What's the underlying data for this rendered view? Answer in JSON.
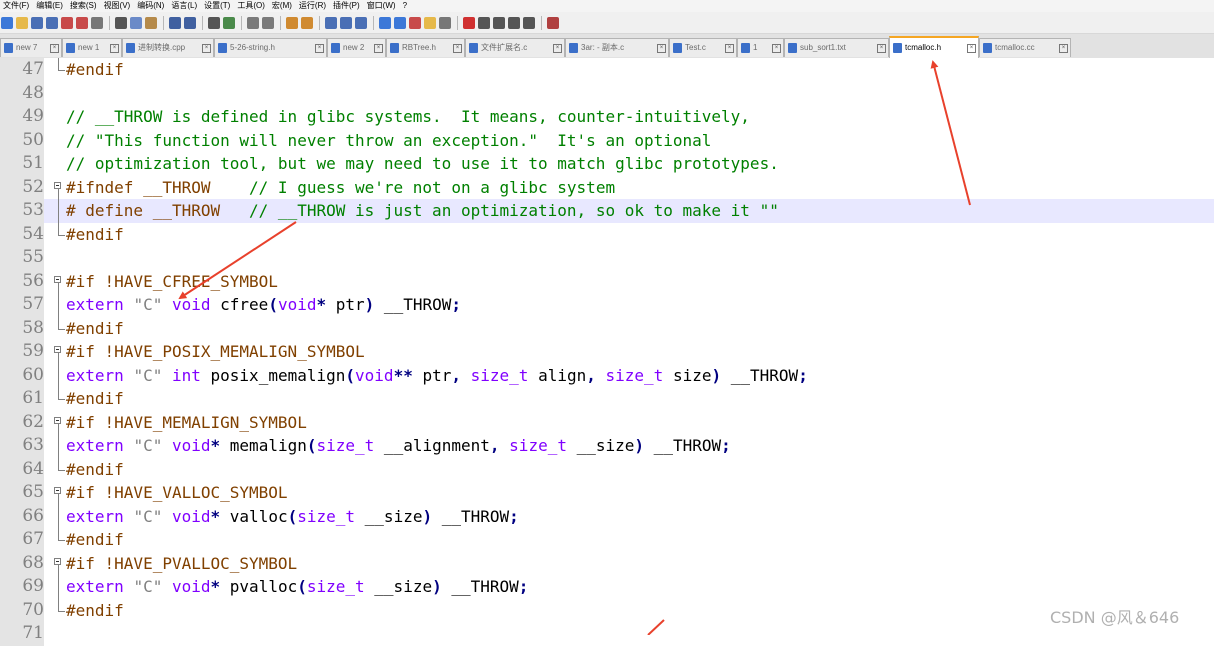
{
  "menu": [
    "文件(F)",
    "编辑(E)",
    "搜索(S)",
    "视图(V)",
    "编码(N)",
    "语言(L)",
    "设置(T)",
    "工具(O)",
    "宏(M)",
    "运行(R)",
    "插件(P)",
    "窗口(W)",
    "?"
  ],
  "toolbar_icons": [
    {
      "name": "new-file-icon",
      "color": "#3c78d8"
    },
    {
      "name": "open-file-icon",
      "color": "#e6b94a"
    },
    {
      "name": "save-icon",
      "color": "#4a6fb5"
    },
    {
      "name": "save-all-icon",
      "color": "#4a6fb5"
    },
    {
      "name": "close-icon",
      "color": "#c84a4a"
    },
    {
      "name": "close-all-icon",
      "color": "#c84a4a"
    },
    {
      "name": "print-icon",
      "color": "#777777"
    },
    {
      "name": "sep"
    },
    {
      "name": "cut-icon",
      "color": "#555555"
    },
    {
      "name": "copy-icon",
      "color": "#6a8ac8"
    },
    {
      "name": "paste-icon",
      "color": "#b58a4a"
    },
    {
      "name": "sep"
    },
    {
      "name": "undo-icon",
      "color": "#4060a0"
    },
    {
      "name": "redo-icon",
      "color": "#4060a0"
    },
    {
      "name": "sep"
    },
    {
      "name": "find-icon",
      "color": "#555555"
    },
    {
      "name": "replace-icon",
      "color": "#4a8a4a"
    },
    {
      "name": "sep"
    },
    {
      "name": "zoom-in-icon",
      "color": "#7a7a7a"
    },
    {
      "name": "zoom-out-icon",
      "color": "#7a7a7a"
    },
    {
      "name": "sep"
    },
    {
      "name": "sync-vertical-icon",
      "color": "#d08a30"
    },
    {
      "name": "sync-horizontal-icon",
      "color": "#d08a30"
    },
    {
      "name": "sep"
    },
    {
      "name": "word-wrap-icon",
      "color": "#4a6fb5"
    },
    {
      "name": "show-all-chars-icon",
      "color": "#4a6fb5"
    },
    {
      "name": "indent-guide-icon",
      "color": "#4a6fb5"
    },
    {
      "name": "sep"
    },
    {
      "name": "udl-icon",
      "color": "#3c78d8"
    },
    {
      "name": "doc-map-icon",
      "color": "#3c78d8"
    },
    {
      "name": "function-list-icon",
      "color": "#c84a4a"
    },
    {
      "name": "folder-workspace-icon",
      "color": "#e6b94a"
    },
    {
      "name": "monitoring-icon",
      "color": "#777777"
    },
    {
      "name": "sep"
    },
    {
      "name": "record-macro-icon",
      "color": "#d03030"
    },
    {
      "name": "stop-macro-icon",
      "color": "#555555"
    },
    {
      "name": "play-macro-icon",
      "color": "#555555"
    },
    {
      "name": "play-multiple-icon",
      "color": "#555555"
    },
    {
      "name": "save-macro-icon",
      "color": "#555555"
    },
    {
      "name": "sep"
    },
    {
      "name": "spell-check-icon",
      "color": "#b04040"
    }
  ],
  "tabs": [
    {
      "label": "new 7",
      "active": false
    },
    {
      "label": "new 1",
      "active": false
    },
    {
      "label": "进制转换.cpp",
      "active": false
    },
    {
      "label": "5-26-string.h",
      "active": false
    },
    {
      "label": "new 2",
      "active": false
    },
    {
      "label": "RBTree.h",
      "active": false
    },
    {
      "label": "文件扩展名.c",
      "active": false
    },
    {
      "label": "3ar: - 副本.c",
      "active": false
    },
    {
      "label": "Test.c",
      "active": false
    },
    {
      "label": "1",
      "active": false
    },
    {
      "label": "sub_sort1.txt",
      "active": false
    },
    {
      "label": "tcmalloc.h",
      "active": true
    },
    {
      "label": "tcmalloc.cc",
      "active": false
    }
  ],
  "code_lines": [
    {
      "n": "47",
      "fold": "end",
      "hl": false,
      "tokens": [
        {
          "c": "pp",
          "t": "#endif"
        }
      ]
    },
    {
      "n": "48",
      "fold": "",
      "hl": false,
      "tokens": []
    },
    {
      "n": "49",
      "fold": "",
      "hl": false,
      "tokens": [
        {
          "c": "cm",
          "t": "// __THROW is defined in glibc systems.  It means, counter-intuitively,"
        }
      ]
    },
    {
      "n": "50",
      "fold": "",
      "hl": false,
      "tokens": [
        {
          "c": "cm",
          "t": "// \"This function will never throw an exception.\"  It's an optional"
        }
      ]
    },
    {
      "n": "51",
      "fold": "",
      "hl": false,
      "tokens": [
        {
          "c": "cm",
          "t": "// optimization tool, but we may need to use it to match glibc prototypes."
        }
      ]
    },
    {
      "n": "52",
      "fold": "start",
      "hl": false,
      "tokens": [
        {
          "c": "pp",
          "t": "#ifndef __THROW    "
        },
        {
          "c": "cm",
          "t": "// I guess we're not on a glibc system"
        }
      ]
    },
    {
      "n": "53",
      "fold": "mid",
      "hl": true,
      "tokens": [
        {
          "c": "pp",
          "t": "# define __THROW   "
        },
        {
          "c": "cm",
          "t": "// __THROW is just an optimization, so ok to make it \"\""
        }
      ]
    },
    {
      "n": "54",
      "fold": "end",
      "hl": false,
      "tokens": [
        {
          "c": "pp",
          "t": "#endif"
        }
      ]
    },
    {
      "n": "55",
      "fold": "",
      "hl": false,
      "tokens": []
    },
    {
      "n": "56",
      "fold": "start",
      "hl": false,
      "tokens": [
        {
          "c": "pp",
          "t": "#if !HAVE_CFREE_SYMBOL"
        }
      ]
    },
    {
      "n": "57",
      "fold": "mid",
      "hl": false,
      "tokens": [
        {
          "c": "kw",
          "t": "extern"
        },
        {
          "c": "fn",
          "t": " "
        },
        {
          "c": "st",
          "t": "\"C\""
        },
        {
          "c": "fn",
          "t": " "
        },
        {
          "c": "ty",
          "t": "void"
        },
        {
          "c": "fn",
          "t": " cfree"
        },
        {
          "c": "op",
          "t": "("
        },
        {
          "c": "ty",
          "t": "void"
        },
        {
          "c": "op",
          "t": "*"
        },
        {
          "c": "fn",
          "t": " ptr"
        },
        {
          "c": "op",
          "t": ")"
        },
        {
          "c": "fn",
          "t": " __THROW"
        },
        {
          "c": "op",
          "t": ";"
        }
      ]
    },
    {
      "n": "58",
      "fold": "end",
      "hl": false,
      "tokens": [
        {
          "c": "pp",
          "t": "#endif"
        }
      ]
    },
    {
      "n": "59",
      "fold": "start",
      "hl": false,
      "tokens": [
        {
          "c": "pp",
          "t": "#if !HAVE_POSIX_MEMALIGN_SYMBOL"
        }
      ]
    },
    {
      "n": "60",
      "fold": "mid",
      "hl": false,
      "tokens": [
        {
          "c": "kw",
          "t": "extern"
        },
        {
          "c": "fn",
          "t": " "
        },
        {
          "c": "st",
          "t": "\"C\""
        },
        {
          "c": "fn",
          "t": " "
        },
        {
          "c": "ty",
          "t": "int"
        },
        {
          "c": "fn",
          "t": " posix_memalign"
        },
        {
          "c": "op",
          "t": "("
        },
        {
          "c": "ty",
          "t": "void"
        },
        {
          "c": "op",
          "t": "**"
        },
        {
          "c": "fn",
          "t": " ptr"
        },
        {
          "c": "op",
          "t": ","
        },
        {
          "c": "fn",
          "t": " "
        },
        {
          "c": "ty",
          "t": "size_t"
        },
        {
          "c": "fn",
          "t": " align"
        },
        {
          "c": "op",
          "t": ","
        },
        {
          "c": "fn",
          "t": " "
        },
        {
          "c": "ty",
          "t": "size_t"
        },
        {
          "c": "fn",
          "t": " size"
        },
        {
          "c": "op",
          "t": ")"
        },
        {
          "c": "fn",
          "t": " __THROW"
        },
        {
          "c": "op",
          "t": ";"
        }
      ]
    },
    {
      "n": "61",
      "fold": "end",
      "hl": false,
      "tokens": [
        {
          "c": "pp",
          "t": "#endif"
        }
      ]
    },
    {
      "n": "62",
      "fold": "start",
      "hl": false,
      "tokens": [
        {
          "c": "pp",
          "t": "#if !HAVE_MEMALIGN_SYMBOL"
        }
      ]
    },
    {
      "n": "63",
      "fold": "mid",
      "hl": false,
      "tokens": [
        {
          "c": "kw",
          "t": "extern"
        },
        {
          "c": "fn",
          "t": " "
        },
        {
          "c": "st",
          "t": "\"C\""
        },
        {
          "c": "fn",
          "t": " "
        },
        {
          "c": "ty",
          "t": "void"
        },
        {
          "c": "op",
          "t": "*"
        },
        {
          "c": "fn",
          "t": " memalign"
        },
        {
          "c": "op",
          "t": "("
        },
        {
          "c": "ty",
          "t": "size_t"
        },
        {
          "c": "fn",
          "t": " __alignment"
        },
        {
          "c": "op",
          "t": ","
        },
        {
          "c": "fn",
          "t": " "
        },
        {
          "c": "ty",
          "t": "size_t"
        },
        {
          "c": "fn",
          "t": " __size"
        },
        {
          "c": "op",
          "t": ")"
        },
        {
          "c": "fn",
          "t": " __THROW"
        },
        {
          "c": "op",
          "t": ";"
        }
      ]
    },
    {
      "n": "64",
      "fold": "end",
      "hl": false,
      "tokens": [
        {
          "c": "pp",
          "t": "#endif"
        }
      ]
    },
    {
      "n": "65",
      "fold": "start",
      "hl": false,
      "tokens": [
        {
          "c": "pp",
          "t": "#if !HAVE_VALLOC_SYMBOL"
        }
      ]
    },
    {
      "n": "66",
      "fold": "mid",
      "hl": false,
      "tokens": [
        {
          "c": "kw",
          "t": "extern"
        },
        {
          "c": "fn",
          "t": " "
        },
        {
          "c": "st",
          "t": "\"C\""
        },
        {
          "c": "fn",
          "t": " "
        },
        {
          "c": "ty",
          "t": "void"
        },
        {
          "c": "op",
          "t": "*"
        },
        {
          "c": "fn",
          "t": " valloc"
        },
        {
          "c": "op",
          "t": "("
        },
        {
          "c": "ty",
          "t": "size_t"
        },
        {
          "c": "fn",
          "t": " __size"
        },
        {
          "c": "op",
          "t": ")"
        },
        {
          "c": "fn",
          "t": " __THROW"
        },
        {
          "c": "op",
          "t": ";"
        }
      ]
    },
    {
      "n": "67",
      "fold": "end",
      "hl": false,
      "tokens": [
        {
          "c": "pp",
          "t": "#endif"
        }
      ]
    },
    {
      "n": "68",
      "fold": "start",
      "hl": false,
      "tokens": [
        {
          "c": "pp",
          "t": "#if !HAVE_PVALLOC_SYMBOL"
        }
      ]
    },
    {
      "n": "69",
      "fold": "mid",
      "hl": false,
      "tokens": [
        {
          "c": "kw",
          "t": "extern"
        },
        {
          "c": "fn",
          "t": " "
        },
        {
          "c": "st",
          "t": "\"C\""
        },
        {
          "c": "fn",
          "t": " "
        },
        {
          "c": "ty",
          "t": "void"
        },
        {
          "c": "op",
          "t": "*"
        },
        {
          "c": "fn",
          "t": " pvalloc"
        },
        {
          "c": "op",
          "t": "("
        },
        {
          "c": "ty",
          "t": "size_t"
        },
        {
          "c": "fn",
          "t": " __size"
        },
        {
          "c": "op",
          "t": ")"
        },
        {
          "c": "fn",
          "t": " __THROW"
        },
        {
          "c": "op",
          "t": ";"
        }
      ]
    },
    {
      "n": "70",
      "fold": "end",
      "hl": false,
      "tokens": [
        {
          "c": "pp",
          "t": "#endif"
        }
      ]
    },
    {
      "n": "71",
      "fold": "",
      "hl": false,
      "tokens": []
    }
  ],
  "watermark": "CSDN @风＆646",
  "annotation_color": "#e8412c"
}
